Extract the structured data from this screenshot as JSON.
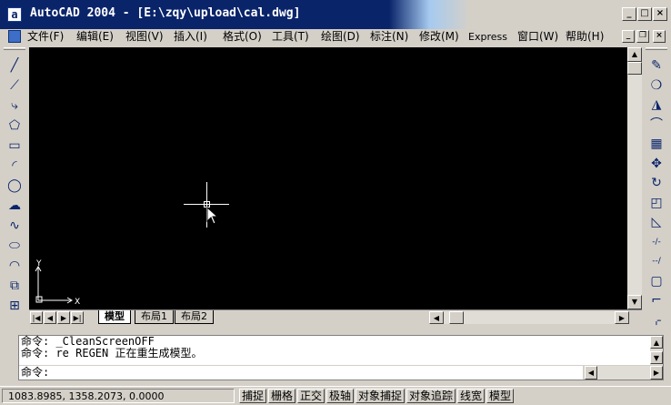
{
  "window": {
    "title": "AutoCAD 2004 - [E:\\zqy\\upload\\cal.dwg]",
    "app_icon": "a",
    "controls": {
      "minimize": "_",
      "maximize": "□",
      "close": "×"
    }
  },
  "menubar": {
    "items": [
      "文件(F)",
      "编辑(E)",
      "视图(V)",
      "插入(I)",
      "格式(O)",
      "工具(T)",
      "绘图(D)",
      "标注(N)",
      "修改(M)",
      "Express",
      "窗口(W)",
      "帮助(H)"
    ],
    "doc_controls": {
      "minimize": "_",
      "restore": "❐",
      "close": "×"
    }
  },
  "draw_toolbar": {
    "tools": [
      {
        "name": "line-icon",
        "glyph": "╱"
      },
      {
        "name": "construction-line-icon",
        "glyph": "⟋"
      },
      {
        "name": "polyline-icon",
        "glyph": "⤷"
      },
      {
        "name": "polygon-icon",
        "glyph": "⬠"
      },
      {
        "name": "rectangle-icon",
        "glyph": "▭"
      },
      {
        "name": "arc-icon",
        "glyph": "◜"
      },
      {
        "name": "circle-icon",
        "glyph": "◯"
      },
      {
        "name": "revision-cloud-icon",
        "glyph": "☁"
      },
      {
        "name": "spline-icon",
        "glyph": "∿"
      },
      {
        "name": "ellipse-icon",
        "glyph": "⬭"
      },
      {
        "name": "ellipse-arc-icon",
        "glyph": "◠"
      },
      {
        "name": "insert-block-icon",
        "glyph": "⧉"
      },
      {
        "name": "make-block-icon",
        "glyph": "⊞"
      }
    ]
  },
  "modify_toolbar": {
    "tools": [
      {
        "name": "erase-icon",
        "glyph": "✎"
      },
      {
        "name": "copy-icon",
        "glyph": "❍"
      },
      {
        "name": "mirror-icon",
        "glyph": "◮"
      },
      {
        "name": "offset-icon",
        "glyph": "⌒"
      },
      {
        "name": "array-icon",
        "glyph": "▦"
      },
      {
        "name": "move-icon",
        "glyph": "✥"
      },
      {
        "name": "rotate-icon",
        "glyph": "↻"
      },
      {
        "name": "scale-icon",
        "glyph": "◰"
      },
      {
        "name": "stretch-icon",
        "glyph": "◺"
      },
      {
        "name": "trim-icon",
        "glyph": "-/-"
      },
      {
        "name": "extend-icon",
        "glyph": "--/"
      },
      {
        "name": "break-icon",
        "glyph": "▢"
      },
      {
        "name": "chamfer-icon",
        "glyph": "⌐"
      },
      {
        "name": "fillet-icon",
        "glyph": "⌌"
      }
    ]
  },
  "canvas": {
    "background": "#000000",
    "ucs": {
      "x_label": "X",
      "y_label": "Y"
    }
  },
  "layout_tabs": {
    "nav": [
      "|◀",
      "◀",
      "▶",
      "▶|"
    ],
    "tabs": [
      {
        "label": "模型",
        "active": true
      },
      {
        "label": "布局1",
        "active": false
      },
      {
        "label": "布局2",
        "active": false
      }
    ]
  },
  "command": {
    "history": [
      "命令: _CleanScreenOFF",
      "命令: re REGEN 正在重生成模型。"
    ],
    "prompt": "命令:"
  },
  "statusbar": {
    "coords": "1083.8985, 1358.2073, 0.0000",
    "toggles": [
      "捕捉",
      "栅格",
      "正交",
      "极轴",
      "对象捕捉",
      "对象追踪",
      "线宽",
      "模型"
    ]
  }
}
